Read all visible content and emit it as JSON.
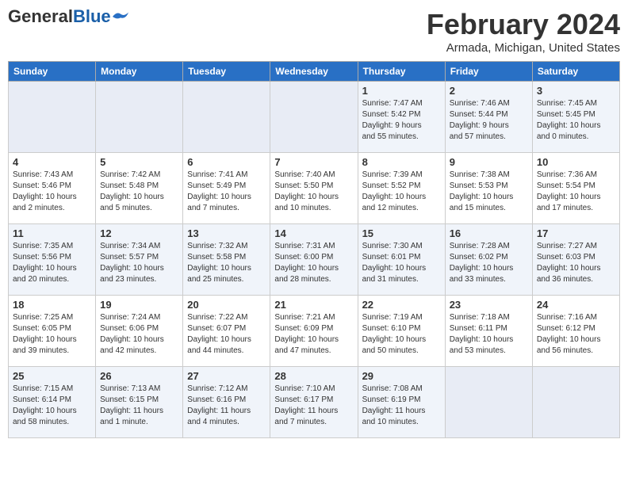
{
  "header": {
    "logo": {
      "general": "General",
      "blue": "Blue"
    },
    "title": "February 2024",
    "location": "Armada, Michigan, United States"
  },
  "days_of_week": [
    "Sunday",
    "Monday",
    "Tuesday",
    "Wednesday",
    "Thursday",
    "Friday",
    "Saturday"
  ],
  "weeks": [
    [
      {
        "day": "",
        "info": ""
      },
      {
        "day": "",
        "info": ""
      },
      {
        "day": "",
        "info": ""
      },
      {
        "day": "",
        "info": ""
      },
      {
        "day": "1",
        "info": "Sunrise: 7:47 AM\nSunset: 5:42 PM\nDaylight: 9 hours\nand 55 minutes."
      },
      {
        "day": "2",
        "info": "Sunrise: 7:46 AM\nSunset: 5:44 PM\nDaylight: 9 hours\nand 57 minutes."
      },
      {
        "day": "3",
        "info": "Sunrise: 7:45 AM\nSunset: 5:45 PM\nDaylight: 10 hours\nand 0 minutes."
      }
    ],
    [
      {
        "day": "4",
        "info": "Sunrise: 7:43 AM\nSunset: 5:46 PM\nDaylight: 10 hours\nand 2 minutes."
      },
      {
        "day": "5",
        "info": "Sunrise: 7:42 AM\nSunset: 5:48 PM\nDaylight: 10 hours\nand 5 minutes."
      },
      {
        "day": "6",
        "info": "Sunrise: 7:41 AM\nSunset: 5:49 PM\nDaylight: 10 hours\nand 7 minutes."
      },
      {
        "day": "7",
        "info": "Sunrise: 7:40 AM\nSunset: 5:50 PM\nDaylight: 10 hours\nand 10 minutes."
      },
      {
        "day": "8",
        "info": "Sunrise: 7:39 AM\nSunset: 5:52 PM\nDaylight: 10 hours\nand 12 minutes."
      },
      {
        "day": "9",
        "info": "Sunrise: 7:38 AM\nSunset: 5:53 PM\nDaylight: 10 hours\nand 15 minutes."
      },
      {
        "day": "10",
        "info": "Sunrise: 7:36 AM\nSunset: 5:54 PM\nDaylight: 10 hours\nand 17 minutes."
      }
    ],
    [
      {
        "day": "11",
        "info": "Sunrise: 7:35 AM\nSunset: 5:56 PM\nDaylight: 10 hours\nand 20 minutes."
      },
      {
        "day": "12",
        "info": "Sunrise: 7:34 AM\nSunset: 5:57 PM\nDaylight: 10 hours\nand 23 minutes."
      },
      {
        "day": "13",
        "info": "Sunrise: 7:32 AM\nSunset: 5:58 PM\nDaylight: 10 hours\nand 25 minutes."
      },
      {
        "day": "14",
        "info": "Sunrise: 7:31 AM\nSunset: 6:00 PM\nDaylight: 10 hours\nand 28 minutes."
      },
      {
        "day": "15",
        "info": "Sunrise: 7:30 AM\nSunset: 6:01 PM\nDaylight: 10 hours\nand 31 minutes."
      },
      {
        "day": "16",
        "info": "Sunrise: 7:28 AM\nSunset: 6:02 PM\nDaylight: 10 hours\nand 33 minutes."
      },
      {
        "day": "17",
        "info": "Sunrise: 7:27 AM\nSunset: 6:03 PM\nDaylight: 10 hours\nand 36 minutes."
      }
    ],
    [
      {
        "day": "18",
        "info": "Sunrise: 7:25 AM\nSunset: 6:05 PM\nDaylight: 10 hours\nand 39 minutes."
      },
      {
        "day": "19",
        "info": "Sunrise: 7:24 AM\nSunset: 6:06 PM\nDaylight: 10 hours\nand 42 minutes."
      },
      {
        "day": "20",
        "info": "Sunrise: 7:22 AM\nSunset: 6:07 PM\nDaylight: 10 hours\nand 44 minutes."
      },
      {
        "day": "21",
        "info": "Sunrise: 7:21 AM\nSunset: 6:09 PM\nDaylight: 10 hours\nand 47 minutes."
      },
      {
        "day": "22",
        "info": "Sunrise: 7:19 AM\nSunset: 6:10 PM\nDaylight: 10 hours\nand 50 minutes."
      },
      {
        "day": "23",
        "info": "Sunrise: 7:18 AM\nSunset: 6:11 PM\nDaylight: 10 hours\nand 53 minutes."
      },
      {
        "day": "24",
        "info": "Sunrise: 7:16 AM\nSunset: 6:12 PM\nDaylight: 10 hours\nand 56 minutes."
      }
    ],
    [
      {
        "day": "25",
        "info": "Sunrise: 7:15 AM\nSunset: 6:14 PM\nDaylight: 10 hours\nand 58 minutes."
      },
      {
        "day": "26",
        "info": "Sunrise: 7:13 AM\nSunset: 6:15 PM\nDaylight: 11 hours\nand 1 minute."
      },
      {
        "day": "27",
        "info": "Sunrise: 7:12 AM\nSunset: 6:16 PM\nDaylight: 11 hours\nand 4 minutes."
      },
      {
        "day": "28",
        "info": "Sunrise: 7:10 AM\nSunset: 6:17 PM\nDaylight: 11 hours\nand 7 minutes."
      },
      {
        "day": "29",
        "info": "Sunrise: 7:08 AM\nSunset: 6:19 PM\nDaylight: 11 hours\nand 10 minutes."
      },
      {
        "day": "",
        "info": ""
      },
      {
        "day": "",
        "info": ""
      }
    ]
  ]
}
